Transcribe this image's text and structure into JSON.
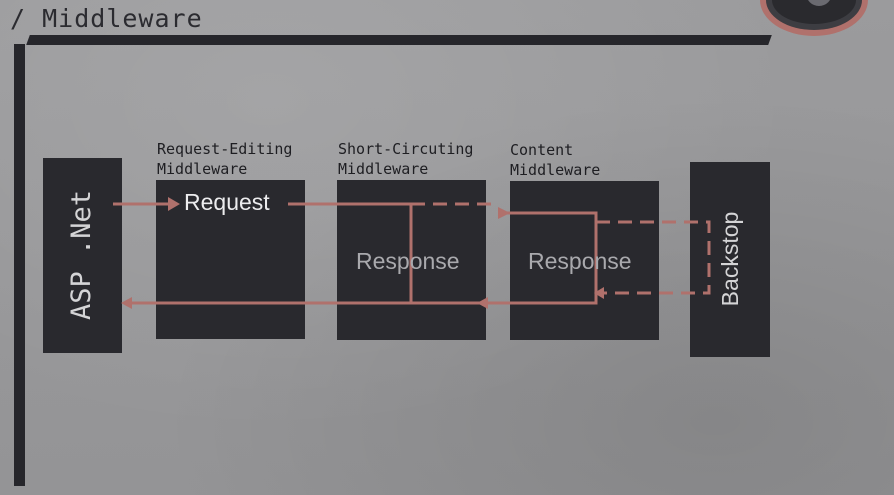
{
  "title": "Middleware",
  "title_mark": "/",
  "nodes": {
    "asp_net": "ASP .Net",
    "request_editing": "Request-Editing\nMiddleware",
    "short_circuiting": "Short-Circuting\nMiddleware",
    "content": "Content\nMiddleware",
    "backstop": "Backstop"
  },
  "flow_labels": {
    "request": "Request",
    "response_short": "Response",
    "response_content": "Response"
  },
  "colors": {
    "background": "#98989a",
    "box": "#29292e",
    "arrow": "#b0716c",
    "frame": "#26262b"
  }
}
